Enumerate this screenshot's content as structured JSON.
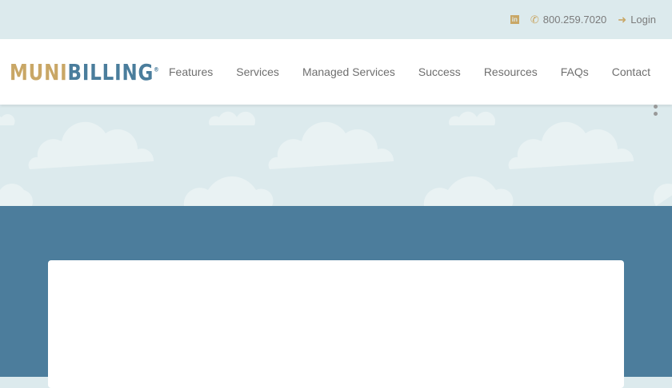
{
  "topbar": {
    "linkedin_icon": "linkedin-icon",
    "phone": "800.259.7020",
    "login": "Login"
  },
  "logo": {
    "part1": "MUNI",
    "part2": "BILLING",
    "reg": "®"
  },
  "nav": {
    "items": [
      "Features",
      "Services",
      "Managed Services",
      "Success",
      "Resources",
      "FAQs",
      "Contact"
    ]
  },
  "colors": {
    "gold": "#c9a766",
    "blue": "#4c7d9c",
    "sky": "#dceaed"
  }
}
